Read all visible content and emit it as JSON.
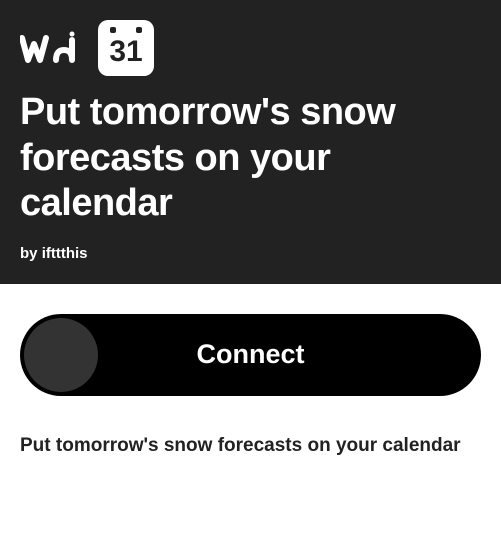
{
  "header": {
    "calendar_number": "31",
    "title": "Put tomorrow's snow forecasts on your calendar",
    "author_prefix": "by ",
    "author_name": "ifttthis"
  },
  "connect": {
    "label": "Connect"
  },
  "description": "Put tomorrow's snow forecasts on your calendar"
}
